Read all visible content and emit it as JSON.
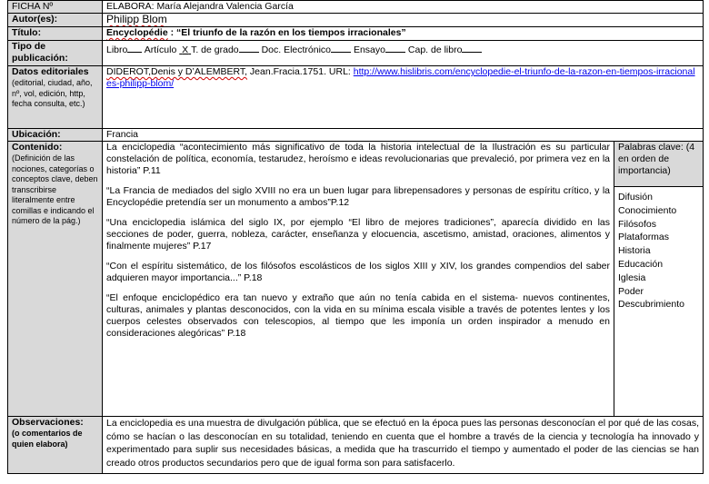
{
  "rows": {
    "ficha": {
      "label": "FICHA Nº",
      "value": "ELABORA: María Alejandra Valencia García"
    },
    "autor": {
      "label": "Autor(es):",
      "value": "Philipp Blom"
    },
    "titulo": {
      "label": "Título:",
      "prefix": "Encyclopédie",
      "rest": " : “El triunfo de la razón en los tiempos irracionales”"
    },
    "tipo": {
      "label": "Tipo de publicación:",
      "libro": "Libro",
      "articulo": "Artículo",
      "articulo_mark": "X",
      "tgrado": "T. de grado",
      "doc": "Doc. Electrónico",
      "ensayo": "Ensayo",
      "cap": "Cap. de libro"
    },
    "datos": {
      "label": "Datos editoriales",
      "sub": "(editorial, ciudad, año, nº, vol, edición, http, fecha consulta, etc.)",
      "authors": "DIDEROT,Denis y D’ALEMBERT,",
      "text": " Jean.Fracia.1751. URL: ",
      "url": "http://www.hislibris.com/encyclopedie-el-triunfo-de-la-razon-en-tiempos-irracionales-philipp-blom/"
    },
    "ubicacion": {
      "label": "Ubicación:",
      "value": "Francia"
    },
    "contenido": {
      "label": "Contenido:",
      "sub": "(Definición de las nociones, categorías o conceptos clave, deben transcribirse literalmente entre comillas e indicando el número de la pág.)",
      "paragraphs": [
        "La enciclopedia “acontecimiento más significativo de toda la historia intelectual de la Ilustración es su particular constelación de política, economía, testarudez, heroísmo e ideas revolucionarias que prevaleció, por primera vez en la historia” P.11",
        "“La Francia de mediados del siglo XVIII no era un buen lugar para librepensadores y personas de espíritu crítico, y la Encyclopédie pretendía ser un monumento a ambos”P.12",
        "“Una enciclopedia islámica del siglo IX, por ejemplo “El libro de mejores tradiciones”, aparecía dividido en las secciones de poder, guerra, nobleza, carácter, enseñanza y elocuencia, ascetismo, amistad, oraciones, alimentos y finalmente mujeres” P.17",
        "“Con el espíritu sistemático, de los filósofos escolásticos de los siglos XIII y XIV, los grandes compendios del saber adquieren mayor importancia...” P.18",
        "“El enfoque enciclopédico era tan nuevo y extraño que aún no tenía cabida en el sistema- nuevos continentes, culturas, animales y plantas desconocidos, con la vida en su mínima escala visible a través de potentes lentes y los cuerpos celestes observados con telescopios, al tiempo que les imponía un orden inspirador a menudo en consideraciones alegóricas” P.18"
      ]
    },
    "keywords": {
      "header": "Palabras clave: (4 en orden de importancia)",
      "items": [
        "Difusión",
        "Conocimiento",
        "Filósofos",
        "Plataformas",
        "Historia",
        "Educación",
        "Iglesia",
        "Poder",
        "Descubrimiento"
      ]
    },
    "observaciones": {
      "label": "Observaciones:",
      "sub": "(o comentarios de quien elabora)",
      "value": "La enciclopedia es una muestra de divulgación pública, que se efectuó en la época pues las personas desconocían el por qué de las cosas, cómo se hacían o las desconocían en su totalidad, teniendo en cuenta que el hombre a través de la ciencia y tecnología ha innovado y experimentado para suplir sus necesidades básicas, a medida que ha trascurrido el tiempo y aumentado el poder de las ciencias se han creado otros productos secundarios pero que de igual forma son para satisfacerlo."
    }
  }
}
